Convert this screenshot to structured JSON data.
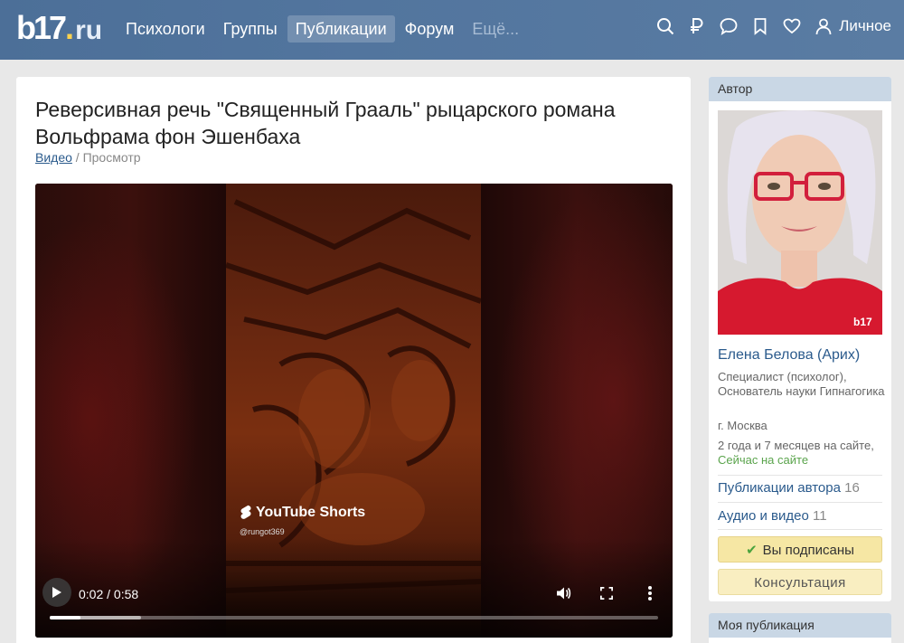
{
  "header": {
    "logo": {
      "main": "b17",
      "dot": ".",
      "tld": "ru"
    },
    "nav": [
      {
        "label": "Психологи",
        "active": false
      },
      {
        "label": "Группы",
        "active": false
      },
      {
        "label": "Публикации",
        "active": true
      },
      {
        "label": "Форум",
        "active": false
      },
      {
        "label": "Ещё...",
        "active": false,
        "muted": true
      }
    ],
    "tools": [
      "search-icon",
      "ruble-icon",
      "chat-icon",
      "bookmark-icon",
      "heart-icon"
    ],
    "personal_label": "Личное"
  },
  "article": {
    "title": "Реверсивная речь \"Священный Грааль\" рыцарского романа Вольфрама фон Эшенбаха",
    "breadcrumb": {
      "link": "Видео",
      "separator": "/",
      "current": "Просмотр"
    }
  },
  "video": {
    "overlay_brand": "YouTube Shorts",
    "overlay_handle": "@rungot369",
    "time": "0:02 / 0:58",
    "progress_played": 0.05,
    "progress_buffered": 0.15
  },
  "sidebar": {
    "author_header": "Автор",
    "author": {
      "name": "Елена Белова (Арих)",
      "role": "Специалист (психолог), Основатель науки Гипнагогика",
      "city": "г. Москва",
      "since": "2 года и 7 месяцев на сайте,",
      "online": "Сейчас на сайте"
    },
    "links": [
      {
        "label": "Публикации автора",
        "count": "16"
      },
      {
        "label": "Аудио и видео",
        "count": "11"
      }
    ],
    "subscribed_label": "Вы подписаны",
    "consult_label": "Консультация",
    "my_publication_header": "Моя публикация"
  },
  "colors": {
    "header": "#52759e",
    "link": "#2a5a8c",
    "online": "#5aa44c",
    "button": "#f6e7a4"
  }
}
